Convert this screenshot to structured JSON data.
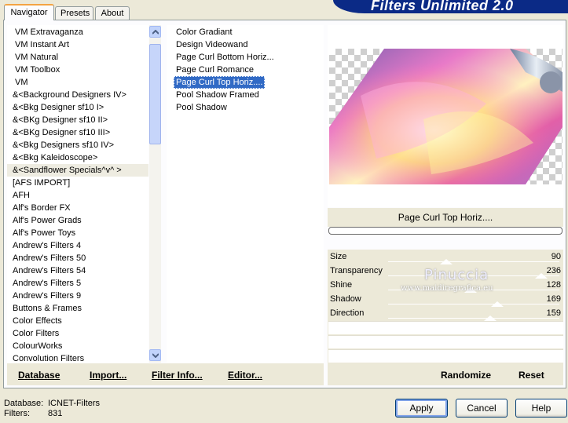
{
  "banner": {
    "title": "Filters Unlimited 2.0"
  },
  "tabs": [
    {
      "label": "Navigator",
      "active": true
    },
    {
      "label": "Presets",
      "active": false
    },
    {
      "label": "About",
      "active": false
    }
  ],
  "categories": [
    "VM Extravaganza",
    "VM Instant Art",
    "VM Natural",
    "VM Toolbox",
    "VM",
    "&<Background Designers IV>",
    "&<Bkg Designer sf10 I>",
    "&<BKg Designer sf10 II>",
    "&<BKg Designer sf10 III>",
    "&<Bkg Designers sf10 IV>",
    "&<Bkg Kaleidoscope>",
    "&<Sandflower Specials^v^ >",
    "[AFS IMPORT]",
    "AFH",
    "Alf's Border FX",
    "Alf's Power Grads",
    "Alf's Power Toys",
    "Andrew's Filters 4",
    "Andrew's Filters 50",
    "Andrew's Filters 54",
    "Andrew's Filters 5",
    "Andrew's Filters 9",
    "Buttons & Frames",
    "Color Effects",
    "Color Filters",
    "ColourWorks",
    "Convolution Filters"
  ],
  "selected_category_index": 11,
  "filters": [
    "Color Gradiant",
    "Design Videowand",
    "Page Curl Bottom Horiz...",
    "Page Curl Romance",
    "Page Curl Top Horiz....",
    "Pool Shadow Framed",
    "Pool Shadow"
  ],
  "selected_filter_index": 4,
  "left_buttons": {
    "database": "Database",
    "import": "Import...",
    "filter_info": "Filter Info...",
    "editor": "Editor..."
  },
  "right_buttons": {
    "randomize": "Randomize",
    "reset": "Reset"
  },
  "preview": {
    "filter_name": "Page Curl Top Horiz...."
  },
  "params": [
    {
      "label": "Size",
      "value": "90",
      "fraction": 0.35
    },
    {
      "label": "Transparency",
      "value": "236",
      "fraction": 0.93
    },
    {
      "label": "Shine",
      "value": "128",
      "fraction": 0.5
    },
    {
      "label": "Shadow",
      "value": "169",
      "fraction": 0.66
    },
    {
      "label": "Direction",
      "value": "159",
      "fraction": 0.62
    }
  ],
  "watermark": {
    "name": "Pinuccia",
    "url": "www.maidiregrafica.eu"
  },
  "footer": {
    "database_label": "Database:",
    "database_value": "ICNET-Filters",
    "filters_label": "Filters:",
    "filters_value": "831",
    "apply": "Apply",
    "cancel": "Cancel",
    "help": "Help"
  }
}
